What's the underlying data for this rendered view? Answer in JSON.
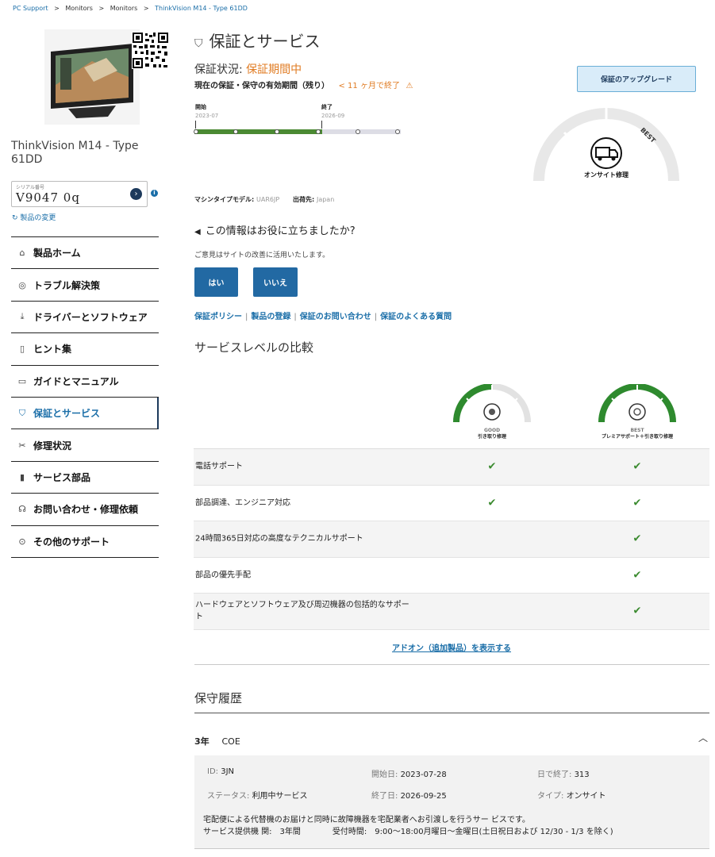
{
  "breadcrumb": {
    "items": [
      "PC Support",
      ">",
      "Monitors",
      ">",
      "Monitors",
      ">",
      "ThinkVision M14 - Type 61DD"
    ]
  },
  "product": {
    "name": "ThinkVision M14 - Type 61DD",
    "serial_label": "シリアル番号",
    "serial_value": "V9047  0q",
    "change_label": "製品の変更"
  },
  "sidebar": {
    "items": [
      {
        "label": "製品ホーム",
        "icon": "home-icon"
      },
      {
        "label": "トラブル解決策",
        "icon": "compass-icon"
      },
      {
        "label": "ドライバーとソフトウェア",
        "icon": "download-icon"
      },
      {
        "label": "ヒント集",
        "icon": "book-icon"
      },
      {
        "label": "ガイドとマニュアル",
        "icon": "manual-icon"
      },
      {
        "label": "保証とサービス",
        "icon": "shield-icon",
        "active": true
      },
      {
        "label": "修理状況",
        "icon": "tools-icon"
      },
      {
        "label": "サービス部品",
        "icon": "part-icon"
      },
      {
        "label": "お問い合わせ・修理依頼",
        "icon": "headset-icon"
      },
      {
        "label": "その他のサポート",
        "icon": "more-icon"
      }
    ]
  },
  "warranty": {
    "title": "保証とサービス",
    "status_label": "保証状況:",
    "status_value": "保証期間中",
    "remaining_label": "現在の保証・保守の有効期間（残り）",
    "remaining_value": "< 11 ヶ月で終了",
    "timeline": {
      "start_label": "開始",
      "start_date": "2023-07",
      "end_label": "終了",
      "end_date": "2026-09",
      "progress": 0.62
    },
    "upgrade_button": "保証のアップグレード",
    "gauge_tag": "BEST",
    "gauge_label": "オンサイト修理",
    "machine_type_label": "マシンタイプモデル:",
    "machine_type_value": "UAR6JP",
    "ship_to_label": "出荷先:",
    "ship_to_value": "Japan"
  },
  "feedback": {
    "question": "この情報はお役に立ちましたか?",
    "sub": "ご意見はサイトの改善に活用いたします。",
    "yes": "はい",
    "no": "いいえ"
  },
  "links": [
    "保証ポリシー",
    "製品の登録",
    "保証のお問い合わせ",
    "保証のよくある質問"
  ],
  "comparison": {
    "title": "サービスレベルの比較",
    "levels": [
      {
        "tag": "GOOD",
        "name": "引き取り修理",
        "fill": 0.5
      },
      {
        "tag": "BEST",
        "name": "プレミアサポート＋引き取り修理",
        "fill": 1.0
      }
    ],
    "rows": [
      {
        "label": "電話サポート",
        "good": true,
        "best": true
      },
      {
        "label": "部品調達、エンジニア対応",
        "good": true,
        "best": true
      },
      {
        "label": "24時間365日対応の高度なテクニカルサポート",
        "good": false,
        "best": true
      },
      {
        "label": "部品の優先手配",
        "good": false,
        "best": true
      },
      {
        "label": "ハードウェアとソフトウェア及び周辺機器の包括的なサポート",
        "good": false,
        "best": true
      }
    ],
    "check_mark": "✔",
    "addon_link": "アドオン（追加製品）を表示する"
  },
  "history": {
    "title": "保守履歴",
    "entry": {
      "duration": "3年",
      "type": "COE",
      "id_label": "ID:",
      "id_value": "3JN",
      "start_label": "開始日:",
      "start_value": "2023-07-28",
      "days_label": "日で終了:",
      "days_value": "313",
      "status_label": "ステータス:",
      "status_value": "利用中サービス",
      "end_label": "終了日:",
      "end_value": "2026-09-25",
      "type_label": "タイプ:",
      "type_value": "オンサイト",
      "desc1": "宅配便による代替機のお届けと同時に故障機器を宅配業者へお引渡しを行うサー ビスです。",
      "desc2": "サービス提供機 関:　3年間　　　　受付時間:　9:00～18:00月曜日～金曜日(土日祝日および 12/30 - 1/3 を除く)"
    }
  }
}
